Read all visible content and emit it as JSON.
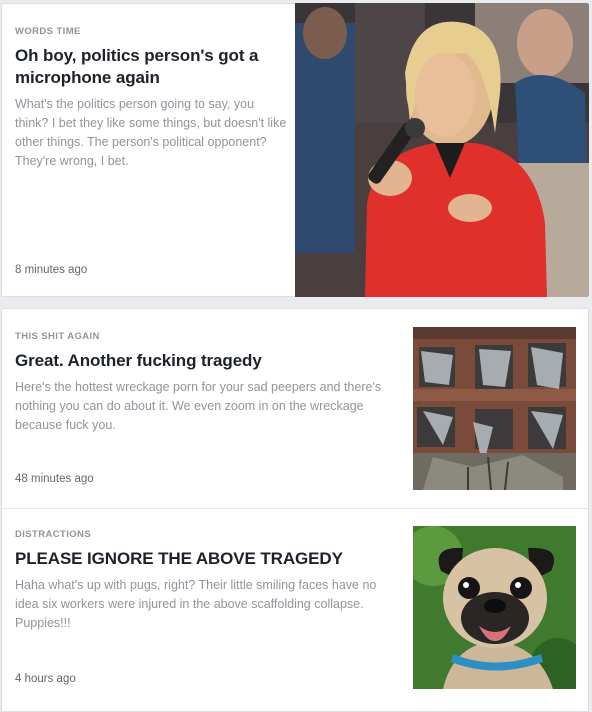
{
  "feed": {
    "stories": [
      {
        "kicker": "WORDS TIME",
        "title": "Oh boy, politics person's got a microphone again",
        "summary": "What's the politics person going to say, you think? I bet they like some things, but doesn't like other things. The person's political opponent? They're wrong, I bet.",
        "time": "8 minutes ago",
        "image_icon": "speaker-with-microphone-photo"
      },
      {
        "kicker": "THIS SHIT AGAIN",
        "title": "Great. Another fucking tragedy",
        "summary": "Here's the hottest wreckage porn for your sad peepers and there's nothing you can do about it. We even zoom in on the wreckage because fuck you.",
        "time": "48 minutes ago",
        "image_icon": "damaged-building-photo"
      },
      {
        "kicker": "DISTRACTIONS",
        "title": "PLEASE IGNORE THE ABOVE TRAGEDY",
        "summary": "Haha what's up with pugs, right? Their little smiling faces have no idea six workers were injured in the above scaffolding collapse. Puppies!!!",
        "time": "4 hours ago",
        "image_icon": "pug-photo"
      }
    ]
  },
  "colors": {
    "background": "#e9ebee",
    "card": "#ffffff",
    "title": "#1d2129",
    "secondary": "#90949c",
    "jacket_red": "#e0302c"
  }
}
